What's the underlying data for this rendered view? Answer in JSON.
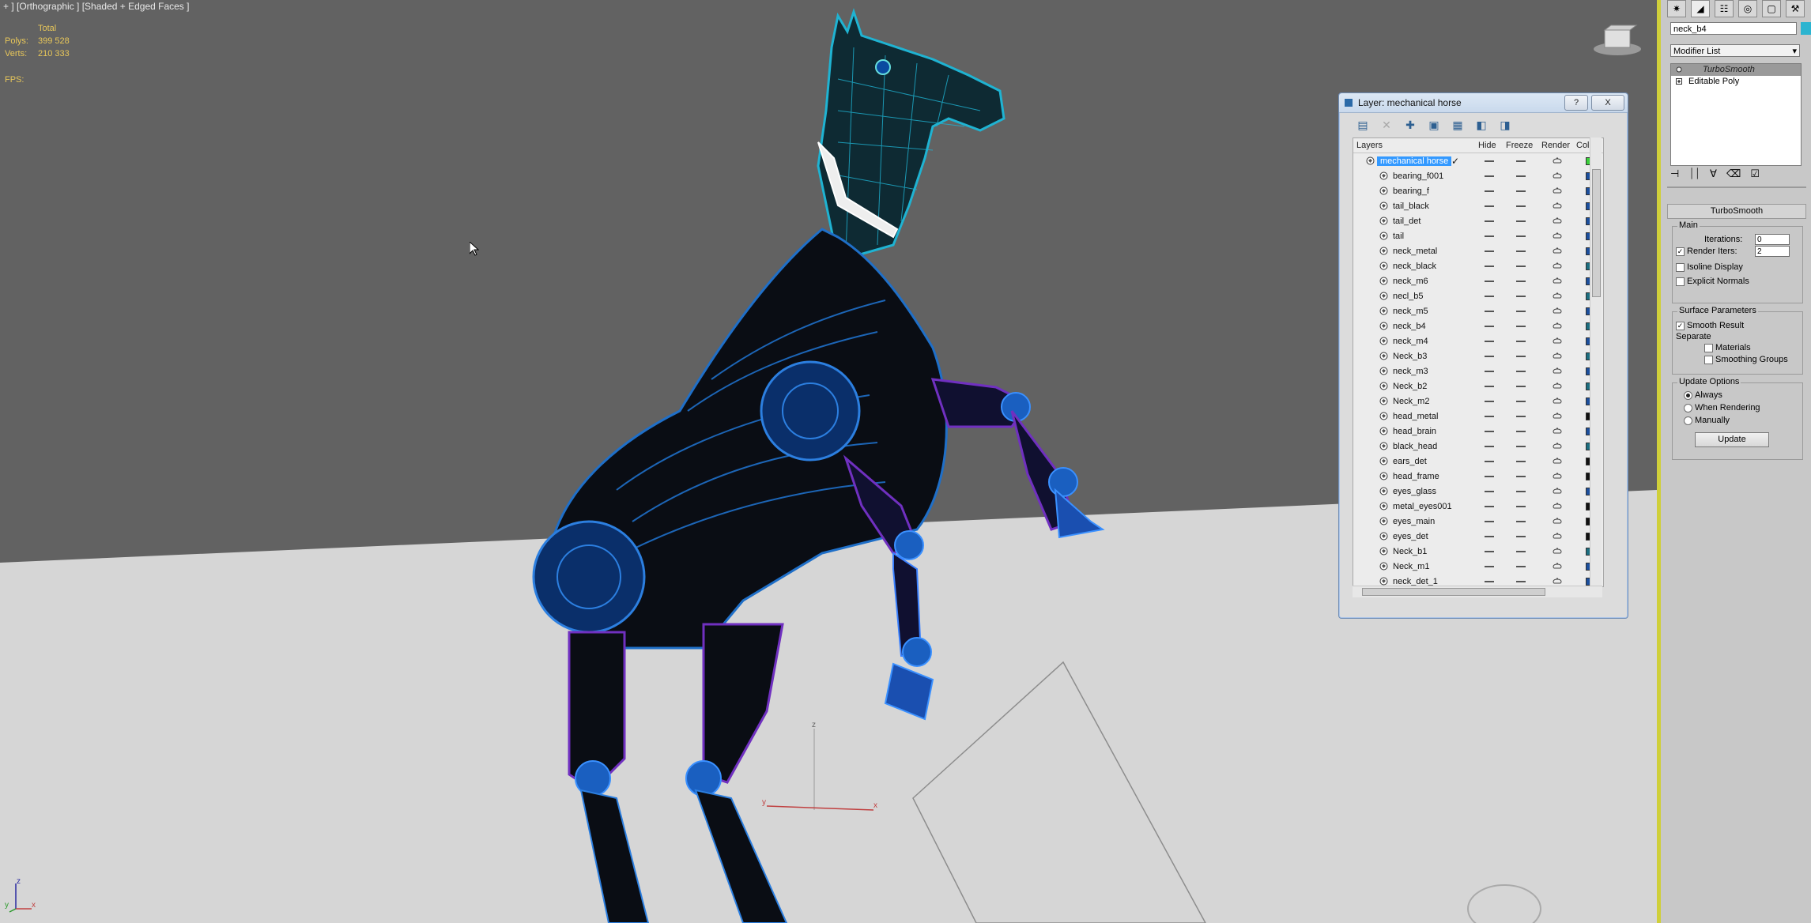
{
  "viewport": {
    "label": "+ ] [Orthographic ] [Shaded + Edged Faces ]",
    "stats": {
      "header": "Total",
      "polys_label": "Polys:",
      "polys": "399 528",
      "verts_label": "Verts:",
      "verts": "210 333"
    },
    "fps_label": "FPS:",
    "axis_labels": {
      "z": "z",
      "y": "y",
      "x": "x"
    },
    "corner_axis": {
      "z": "z",
      "y": "y",
      "x": "x"
    }
  },
  "layer_dialog": {
    "title": "Layer: mechanical horse",
    "help_btn": "?",
    "close_btn": "X",
    "columns": {
      "layers": "Layers",
      "hide": "Hide",
      "freeze": "Freeze",
      "render": "Render",
      "color": "Color"
    },
    "layers": [
      {
        "name": "mechanical horse",
        "color": "#3ad13a",
        "selected": true
      },
      {
        "name": "bearing_f001",
        "color": "#1b4f9e"
      },
      {
        "name": "bearing_f",
        "color": "#1b4f9e"
      },
      {
        "name": "tail_black",
        "color": "#1b4f9e"
      },
      {
        "name": "tail_det",
        "color": "#1b4f9e"
      },
      {
        "name": "tail",
        "color": "#1b4f9e"
      },
      {
        "name": "neck_metal",
        "color": "#1b4f9e"
      },
      {
        "name": "neck_black",
        "color": "#1b6e80"
      },
      {
        "name": "neck_m6",
        "color": "#1b4f9e"
      },
      {
        "name": "necl_b5",
        "color": "#1b6e80"
      },
      {
        "name": "neck_m5",
        "color": "#1b4f9e"
      },
      {
        "name": "neck_b4",
        "color": "#1b6e80"
      },
      {
        "name": "neck_m4",
        "color": "#1b4f9e"
      },
      {
        "name": "Neck_b3",
        "color": "#1b6e80"
      },
      {
        "name": "neck_m3",
        "color": "#1b4f9e"
      },
      {
        "name": "Neck_b2",
        "color": "#1b6e80"
      },
      {
        "name": "Neck_m2",
        "color": "#1b4f9e"
      },
      {
        "name": "head_metal",
        "color": "#111111"
      },
      {
        "name": "head_brain",
        "color": "#1b4f9e"
      },
      {
        "name": "black_head",
        "color": "#1b6e80"
      },
      {
        "name": "ears_det",
        "color": "#111111"
      },
      {
        "name": "head_frame",
        "color": "#111111"
      },
      {
        "name": "eyes_glass",
        "color": "#1b4f9e"
      },
      {
        "name": "metal_eyes001",
        "color": "#111111"
      },
      {
        "name": "eyes_main",
        "color": "#111111"
      },
      {
        "name": "eyes_det",
        "color": "#111111"
      },
      {
        "name": "Neck_b1",
        "color": "#1b6e80"
      },
      {
        "name": "Neck_m1",
        "color": "#1b4f9e"
      },
      {
        "name": "neck_det_1",
        "color": "#1b4f9e"
      }
    ]
  },
  "command_panel": {
    "object_name": "neck_b4",
    "object_color": "#2cb4d0",
    "modifier_list": "Modifier List",
    "stack": [
      "TurboSmooth",
      "Editable Poly"
    ],
    "rollout_title": "TurboSmooth",
    "main_group": "Main",
    "iterations_label": "Iterations:",
    "iterations": "0",
    "render_iters_label": "Render Iters:",
    "render_iters": "2",
    "isoline": "Isoline Display",
    "explicit": "Explicit Normals",
    "surface_group": "Surface Parameters",
    "smooth_result": "Smooth Result",
    "separate": "Separate",
    "materials": "Materials",
    "smoothing_groups": "Smoothing Groups",
    "update_group": "Update Options",
    "always": "Always",
    "when_rendering": "When Rendering",
    "manually": "Manually",
    "update_btn": "Update"
  }
}
